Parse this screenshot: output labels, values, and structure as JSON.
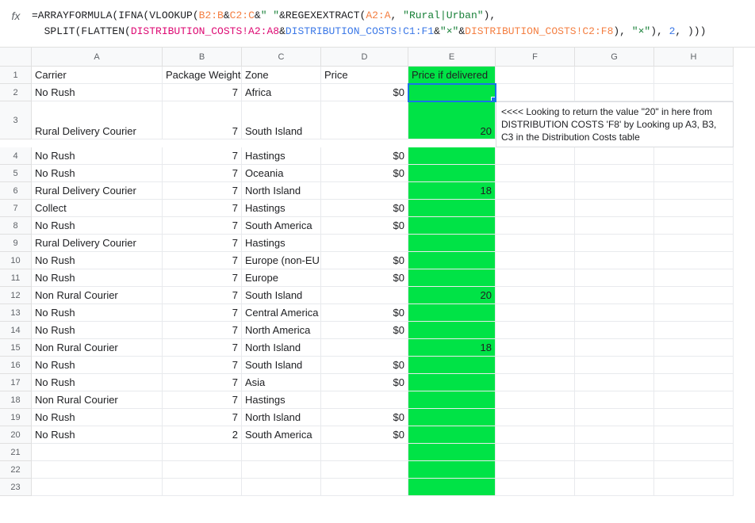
{
  "formula": {
    "line1": {
      "p1": "=ARRAYFORMULA(IFNA(VLOOKUP(",
      "p2": "B2:B",
      "p3": "&",
      "p4": "C2:C",
      "p5": "&",
      "p6": "\" \"",
      "p7": "&REGEXEXTRACT(",
      "p8": "A2:A",
      "p9": ", ",
      "p10": "\"Rural|Urban\"",
      "p11": "),"
    },
    "line2": {
      "p1": "  SPLIT(FLATTEN(",
      "p2": "DISTRIBUTION_COSTS!A2:A8",
      "p3": "&",
      "p4": "DISTRIBUTION_COSTS!C1:F1",
      "p5": "&",
      "p6": "\"×\"",
      "p7": "&",
      "p8": "DISTRIBUTION_COSTS!C2:F8",
      "p9": "), ",
      "p10": "\"×\"",
      "p11": "), ",
      "p12": "2",
      "p13": ", )))"
    }
  },
  "columns": [
    "A",
    "B",
    "C",
    "D",
    "E",
    "F",
    "G",
    "H"
  ],
  "headers": {
    "A": "Carrier",
    "B": "Package Weight",
    "C": "Zone",
    "D": "Price",
    "E": "Price if delivered"
  },
  "note": "<<<< Looking to return the value \"20\" in here from DISTRIBUTION COSTS 'F8' by Looking up A3, B3, C3 in the Distribution Costs table",
  "rows": [
    {
      "n": "1",
      "A": "Carrier",
      "B": "Package Weight",
      "C": "Zone",
      "D": "Price",
      "E": "Price if delivered"
    },
    {
      "n": "2",
      "A": "No Rush",
      "B": "7",
      "C": "Africa",
      "D": "$0",
      "E": ""
    },
    {
      "n": "3",
      "A": "Rural Delivery Courier",
      "B": "7",
      "C": "South Island",
      "D": "",
      "E": "20",
      "tall": true
    },
    {
      "n": "4",
      "A": "No Rush",
      "B": "7",
      "C": "Hastings",
      "D": "$0",
      "E": ""
    },
    {
      "n": "5",
      "A": "No Rush",
      "B": "7",
      "C": "Oceania",
      "D": "$0",
      "E": ""
    },
    {
      "n": "6",
      "A": "Rural Delivery Courier",
      "B": "7",
      "C": "North Island",
      "D": "",
      "E": "18"
    },
    {
      "n": "7",
      "A": "Collect",
      "B": "7",
      "C": "Hastings",
      "D": "$0",
      "E": ""
    },
    {
      "n": "8",
      "A": "No Rush",
      "B": "7",
      "C": "South America",
      "D": "$0",
      "E": ""
    },
    {
      "n": "9",
      "A": "Rural Delivery Courier",
      "B": "7",
      "C": "Hastings",
      "D": "",
      "E": ""
    },
    {
      "n": "10",
      "A": "No Rush",
      "B": "7",
      "C": "Europe (non-EU",
      "D": "$0",
      "E": ""
    },
    {
      "n": "11",
      "A": "No Rush",
      "B": "7",
      "C": "Europe",
      "D": "$0",
      "E": ""
    },
    {
      "n": "12",
      "A": "Non Rural Courier",
      "B": "7",
      "C": "South Island",
      "D": "",
      "E": "20"
    },
    {
      "n": "13",
      "A": "No Rush",
      "B": "7",
      "C": "Central America",
      "D": "$0",
      "E": ""
    },
    {
      "n": "14",
      "A": "No Rush",
      "B": "7",
      "C": "North America",
      "D": "$0",
      "E": ""
    },
    {
      "n": "15",
      "A": "Non Rural Courier",
      "B": "7",
      "C": "North Island",
      "D": "",
      "E": "18"
    },
    {
      "n": "16",
      "A": "No Rush",
      "B": "7",
      "C": "South Island",
      "D": "$0",
      "E": ""
    },
    {
      "n": "17",
      "A": "No Rush",
      "B": "7",
      "C": "Asia",
      "D": "$0",
      "E": ""
    },
    {
      "n": "18",
      "A": "Non Rural Courier",
      "B": "7",
      "C": "Hastings",
      "D": "",
      "E": ""
    },
    {
      "n": "19",
      "A": "No Rush",
      "B": "7",
      "C": "North Island",
      "D": "$0",
      "E": ""
    },
    {
      "n": "20",
      "A": "No Rush",
      "B": "2",
      "C": "South America",
      "D": "$0",
      "E": ""
    },
    {
      "n": "21",
      "A": "",
      "B": "",
      "C": "",
      "D": "",
      "E": ""
    },
    {
      "n": "22",
      "A": "",
      "B": "",
      "C": "",
      "D": "",
      "E": ""
    },
    {
      "n": "23",
      "A": "",
      "B": "",
      "C": "",
      "D": "",
      "E": ""
    }
  ],
  "active_cell": {
    "row": "2",
    "col": "E"
  }
}
